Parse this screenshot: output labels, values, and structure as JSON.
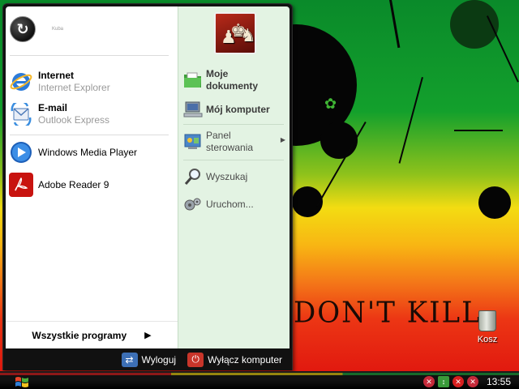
{
  "desktop": {
    "wallpaper_text": "DON'T KILL",
    "recycle_bin_label": "Kosz"
  },
  "start_menu": {
    "user_name": "Kuba",
    "pinned": [
      {
        "title": "Internet",
        "subtitle": "Internet Explorer",
        "icon": "internet-explorer-icon"
      },
      {
        "title": "E-mail",
        "subtitle": "Outlook Express",
        "icon": "outlook-express-icon"
      }
    ],
    "recent": [
      {
        "label": "Windows Media Player",
        "icon": "windows-media-player-icon"
      },
      {
        "label": "Adobe Reader 9",
        "icon": "adobe-reader-icon"
      }
    ],
    "all_programs": "Wszystkie programy",
    "right_column": {
      "my_documents": "Moje dokumenty",
      "my_computer": "Mój komputer",
      "control_panel": "Panel sterowania",
      "search": "Wyszukaj",
      "run": "Uruchom..."
    },
    "footer": {
      "log_off": "Wyloguj",
      "shut_down": "Wyłącz komputer"
    }
  },
  "taskbar": {
    "clock": "13:55"
  },
  "colors": {
    "left_pane": "#ffffff",
    "right_pane": "#e3f3e3",
    "menu_frame": "#111111",
    "subtitle_gray": "#9a9a9a"
  }
}
